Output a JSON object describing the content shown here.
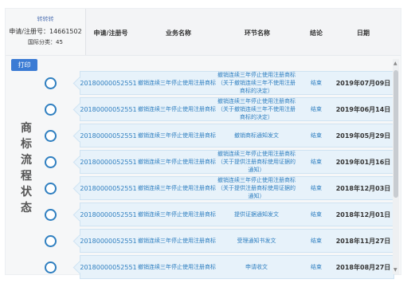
{
  "header": {
    "brand": "转转转",
    "app_no_label": "申请/注册号：14661502",
    "class_label": "国际分类：45"
  },
  "columns": [
    "申请/注册号",
    "业务名称",
    "环节名称",
    "结论",
    "日期"
  ],
  "print_button": "打印",
  "side_title": [
    "商",
    "标",
    "流",
    "程",
    "状",
    "态"
  ],
  "rows": [
    {
      "reg_no": "20180000052551",
      "business": "撤销连续三年停止使用注册商标",
      "step": "撤销连续三年停止使用注册商标（关于撤销连续三年不使用注册商标的决定）",
      "result": "结束",
      "date": "2019年07月09日"
    },
    {
      "reg_no": "20180000052551",
      "business": "撤销连续三年停止使用注册商标",
      "step": "撤销连续三年停止使用注册商标（关于撤销连续三年不使用注册商标的决定）",
      "result": "结束",
      "date": "2019年06月14日"
    },
    {
      "reg_no": "20180000052551",
      "business": "撤销连续三年停止使用注册商标",
      "step": "撤销商标通知发文",
      "result": "结束",
      "date": "2019年05月29日"
    },
    {
      "reg_no": "20180000052551",
      "business": "撤销连续三年停止使用注册商标",
      "step": "撤销连续三年停止使用注册商标（关于提供注册商标使用证据的通知）",
      "result": "结束",
      "date": "2019年01月16日"
    },
    {
      "reg_no": "20180000052551",
      "business": "撤销连续三年停止使用注册商标",
      "step": "撤销连续三年停止使用注册商标（关于提供注册商标使用证据的通知）",
      "result": "结束",
      "date": "2018年12月03日"
    },
    {
      "reg_no": "20180000052551",
      "business": "撤销连续三年停止使用注册商标",
      "step": "提供证据通知发文",
      "result": "结束",
      "date": "2018年12月01日"
    },
    {
      "reg_no": "20180000052551",
      "business": "撤销连续三年停止使用注册商标",
      "step": "受理通知书发文",
      "result": "结束",
      "date": "2018年11月27日"
    },
    {
      "reg_no": "20180000052551",
      "business": "撤销连续三年停止使用注册商标",
      "step": "申请收文",
      "result": "结束",
      "date": "2018年08月27日"
    }
  ]
}
